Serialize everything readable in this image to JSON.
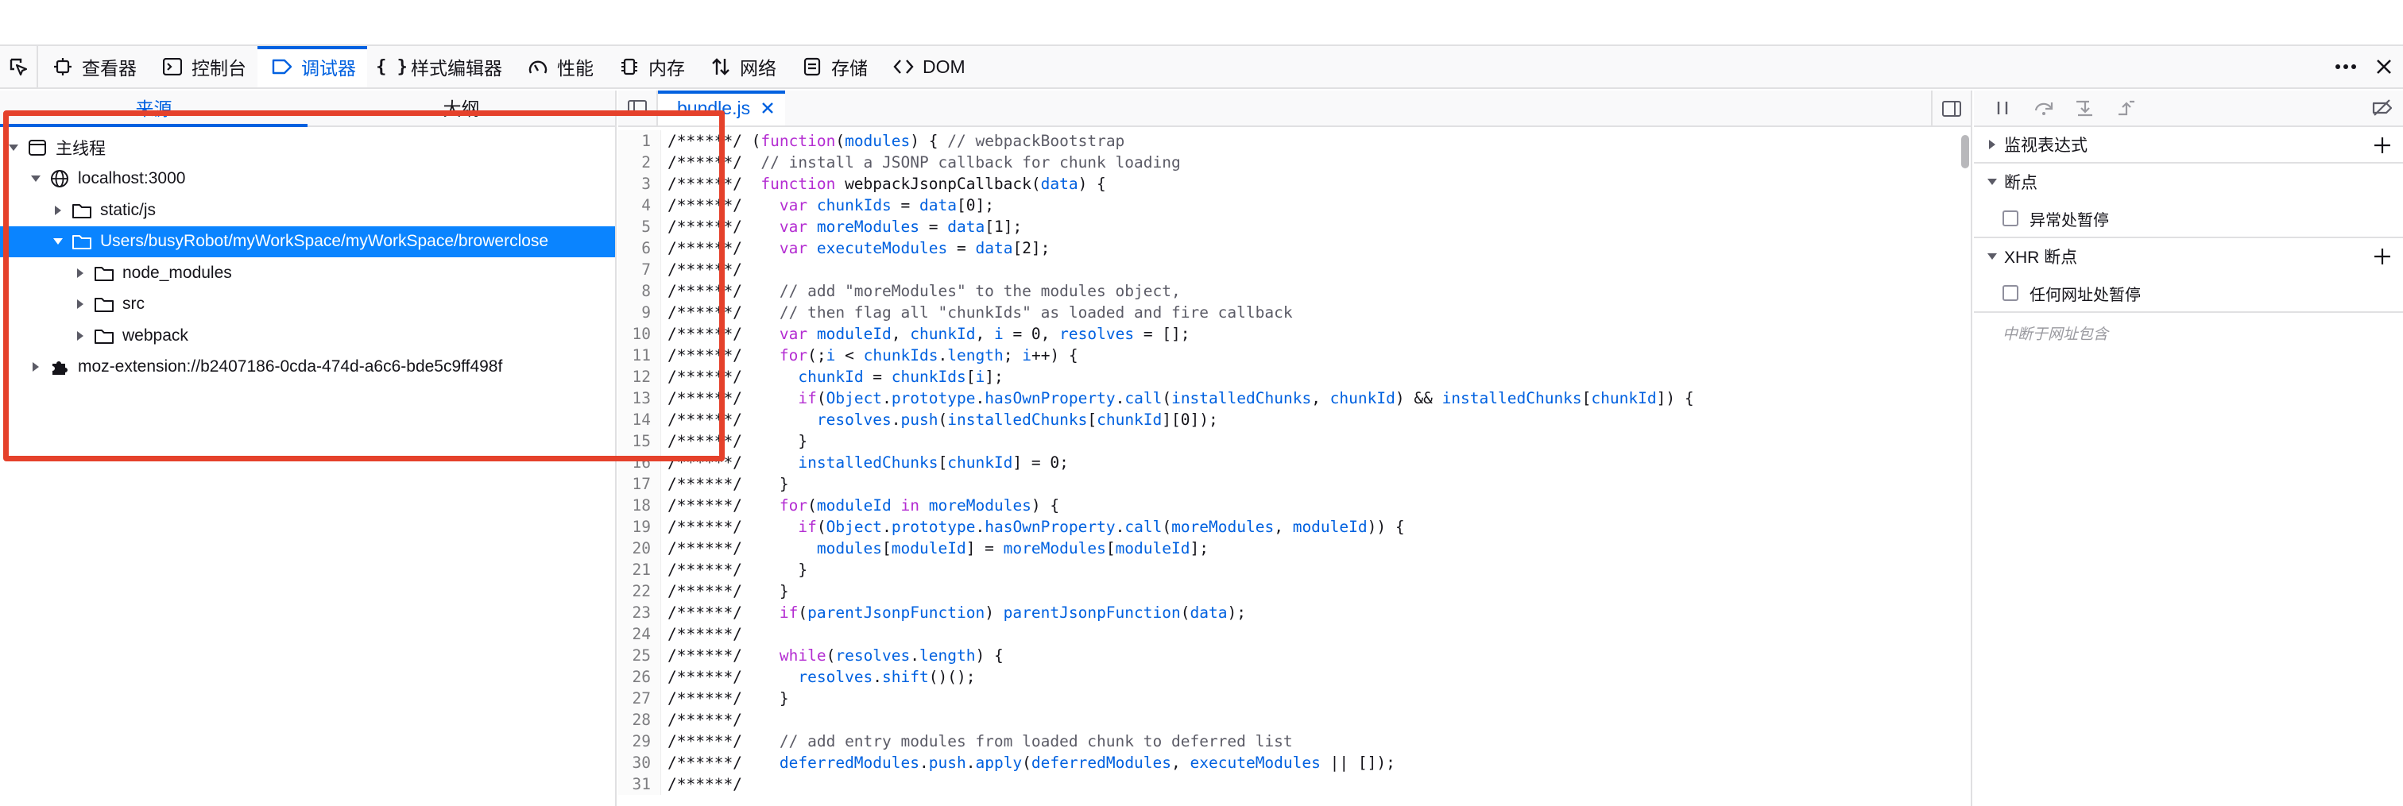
{
  "toolbar": {
    "tabs": [
      {
        "label": "查看器",
        "icon": "inspector-icon"
      },
      {
        "label": "控制台",
        "icon": "console-icon"
      },
      {
        "label": "调试器",
        "icon": "debugger-icon",
        "selected": true
      },
      {
        "label": "样式编辑器",
        "icon": "style-editor-icon"
      },
      {
        "label": "性能",
        "icon": "performance-icon"
      },
      {
        "label": "内存",
        "icon": "memory-icon"
      },
      {
        "label": "网络",
        "icon": "network-icon"
      },
      {
        "label": "存储",
        "icon": "storage-icon"
      },
      {
        "label": "DOM",
        "icon": "dom-icon"
      }
    ]
  },
  "sources": {
    "tabs": [
      "来源",
      "大纲"
    ],
    "tree": [
      {
        "label": "主线程",
        "icon": "thread-icon",
        "expanded": true
      },
      {
        "label": "localhost:3000",
        "icon": "globe-icon",
        "expanded": true
      },
      {
        "label": "static/js",
        "icon": "folder-icon",
        "expanded": false
      },
      {
        "label": "Users/busyRobot/myWorkSpace/myWorkSpace/browerclose",
        "icon": "folder-icon",
        "expanded": true,
        "selected": true
      },
      {
        "label": "node_modules",
        "icon": "folder-icon",
        "expanded": false
      },
      {
        "label": "src",
        "icon": "folder-icon",
        "expanded": false
      },
      {
        "label": "webpack",
        "icon": "folder-icon",
        "expanded": false
      },
      {
        "label": "moz-extension://b2407186-0cda-474d-a6c6-bde5c9ff498f",
        "icon": "extension-icon",
        "expanded": false
      }
    ]
  },
  "editor": {
    "tab_label": "bundle.js",
    "lines": [
      "/******/ (function(modules) { // webpackBootstrap",
      "/******/  // install a JSONP callback for chunk loading",
      "/******/  function webpackJsonpCallback(data) {",
      "/******/    var chunkIds = data[0];",
      "/******/    var moreModules = data[1];",
      "/******/    var executeModules = data[2];",
      "/******/",
      "/******/    // add \"moreModules\" to the modules object,",
      "/******/    // then flag all \"chunkIds\" as loaded and fire callback",
      "/******/    var moduleId, chunkId, i = 0, resolves = [];",
      "/******/    for(;i < chunkIds.length; i++) {",
      "/******/      chunkId = chunkIds[i];",
      "/******/      if(Object.prototype.hasOwnProperty.call(installedChunks, chunkId) && installedChunks[chunkId]) {",
      "/******/        resolves.push(installedChunks[chunkId][0]);",
      "/******/      }",
      "/******/      installedChunks[chunkId] = 0;",
      "/******/    }",
      "/******/    for(moduleId in moreModules) {",
      "/******/      if(Object.prototype.hasOwnProperty.call(moreModules, moduleId)) {",
      "/******/        modules[moduleId] = moreModules[moduleId];",
      "/******/      }",
      "/******/    }",
      "/******/    if(parentJsonpFunction) parentJsonpFunction(data);",
      "/******/",
      "/******/    while(resolves.length) {",
      "/******/      resolves.shift()();",
      "/******/    }",
      "/******/",
      "/******/    // add entry modules from loaded chunk to deferred list",
      "/******/    deferredModules.push.apply(deferredModules, executeModules || []);",
      "/******/"
    ]
  },
  "side": {
    "watch_label": "监视表达式",
    "breakpoints_label": "断点",
    "pause_exceptions_label": "异常处暂停",
    "xhr_label": "XHR 断点",
    "pause_any_url_label": "任何网址处暂停",
    "url_hint": "中断于网址包含"
  },
  "colors": {
    "accent": "#0061e0",
    "selection": "#0a84ff",
    "highlight_box": "#e5412b",
    "keyword": "#b42dd2",
    "identifier": "#0061e0"
  }
}
